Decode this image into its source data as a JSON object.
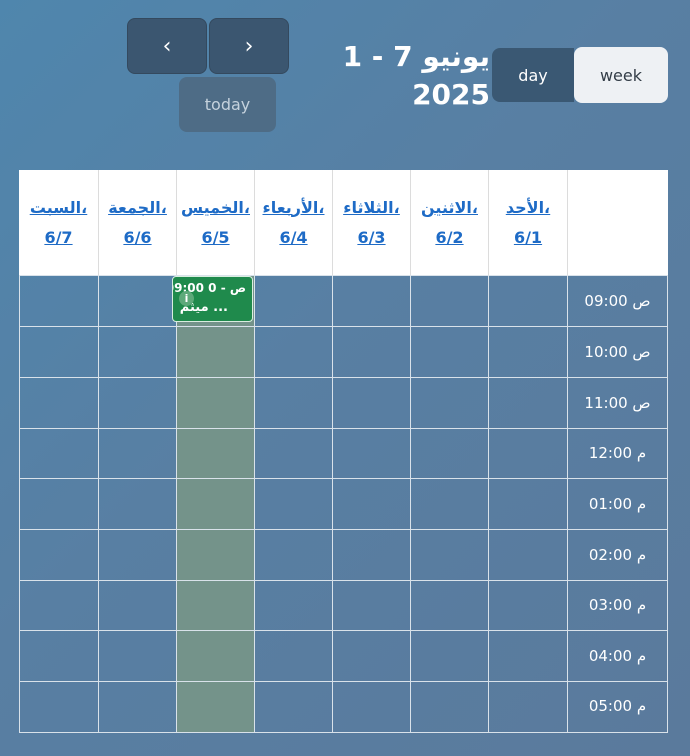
{
  "toolbar": {
    "prev_icon": "chevron-left-icon",
    "next_icon": "chevron-right-icon",
    "prev_glyph": "‹",
    "next_glyph": "›",
    "today_label": "today",
    "title_line1": "1 - 7 يونيو",
    "title_line2": "2025",
    "day_label": "day",
    "week_label": "week"
  },
  "calendar": {
    "days": [
      {
        "name": "السبت،",
        "date": "6/7"
      },
      {
        "name": "الجمعة،",
        "date": "6/6"
      },
      {
        "name": "الخميس،",
        "date": "6/5"
      },
      {
        "name": "الأربعاء،",
        "date": "6/4"
      },
      {
        "name": "الثلاثاء،",
        "date": "6/3"
      },
      {
        "name": "الاثنين،",
        "date": "6/2"
      },
      {
        "name": "الأحد،",
        "date": "6/1"
      }
    ],
    "times": [
      "09:00 ص",
      "10:00 ص",
      "11:00 ص",
      "12:00 م",
      "01:00 م",
      "02:00 م",
      "03:00 م",
      "04:00 م",
      "05:00 م"
    ],
    "event": {
      "time": "09:00 ص - 0",
      "title": "ميثم ...",
      "icon": "info-icon",
      "icon_glyph": "i"
    }
  },
  "colors": {
    "event_bg": "#1f8a4c",
    "today_highlight": "#74938a",
    "link": "#1e6bc6"
  }
}
